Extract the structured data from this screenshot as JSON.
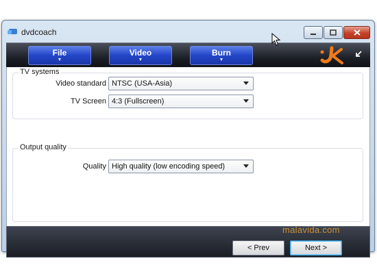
{
  "window": {
    "title": "dvdcoach"
  },
  "toolbar": {
    "tabs": [
      {
        "label": "File"
      },
      {
        "label": "Video"
      },
      {
        "label": "Burn"
      }
    ]
  },
  "tv_systems": {
    "legend": "TV systems",
    "video_standard": {
      "label": "Video standard",
      "value": "NTSC (USA-Asia)"
    },
    "tv_screen": {
      "label": "TV Screen",
      "value": "4:3 (Fullscreen)"
    }
  },
  "output_quality": {
    "legend": "Output quality",
    "quality": {
      "label": "Quality",
      "value": "High quality (low encoding speed)"
    }
  },
  "nav": {
    "prev_label": "< Prev",
    "next_label": "Next >"
  },
  "watermark": "malavida.com",
  "colors": {
    "tab_blue": "#2346c8",
    "logo_orange": "#f07a1a",
    "close_red": "#c4422a"
  }
}
